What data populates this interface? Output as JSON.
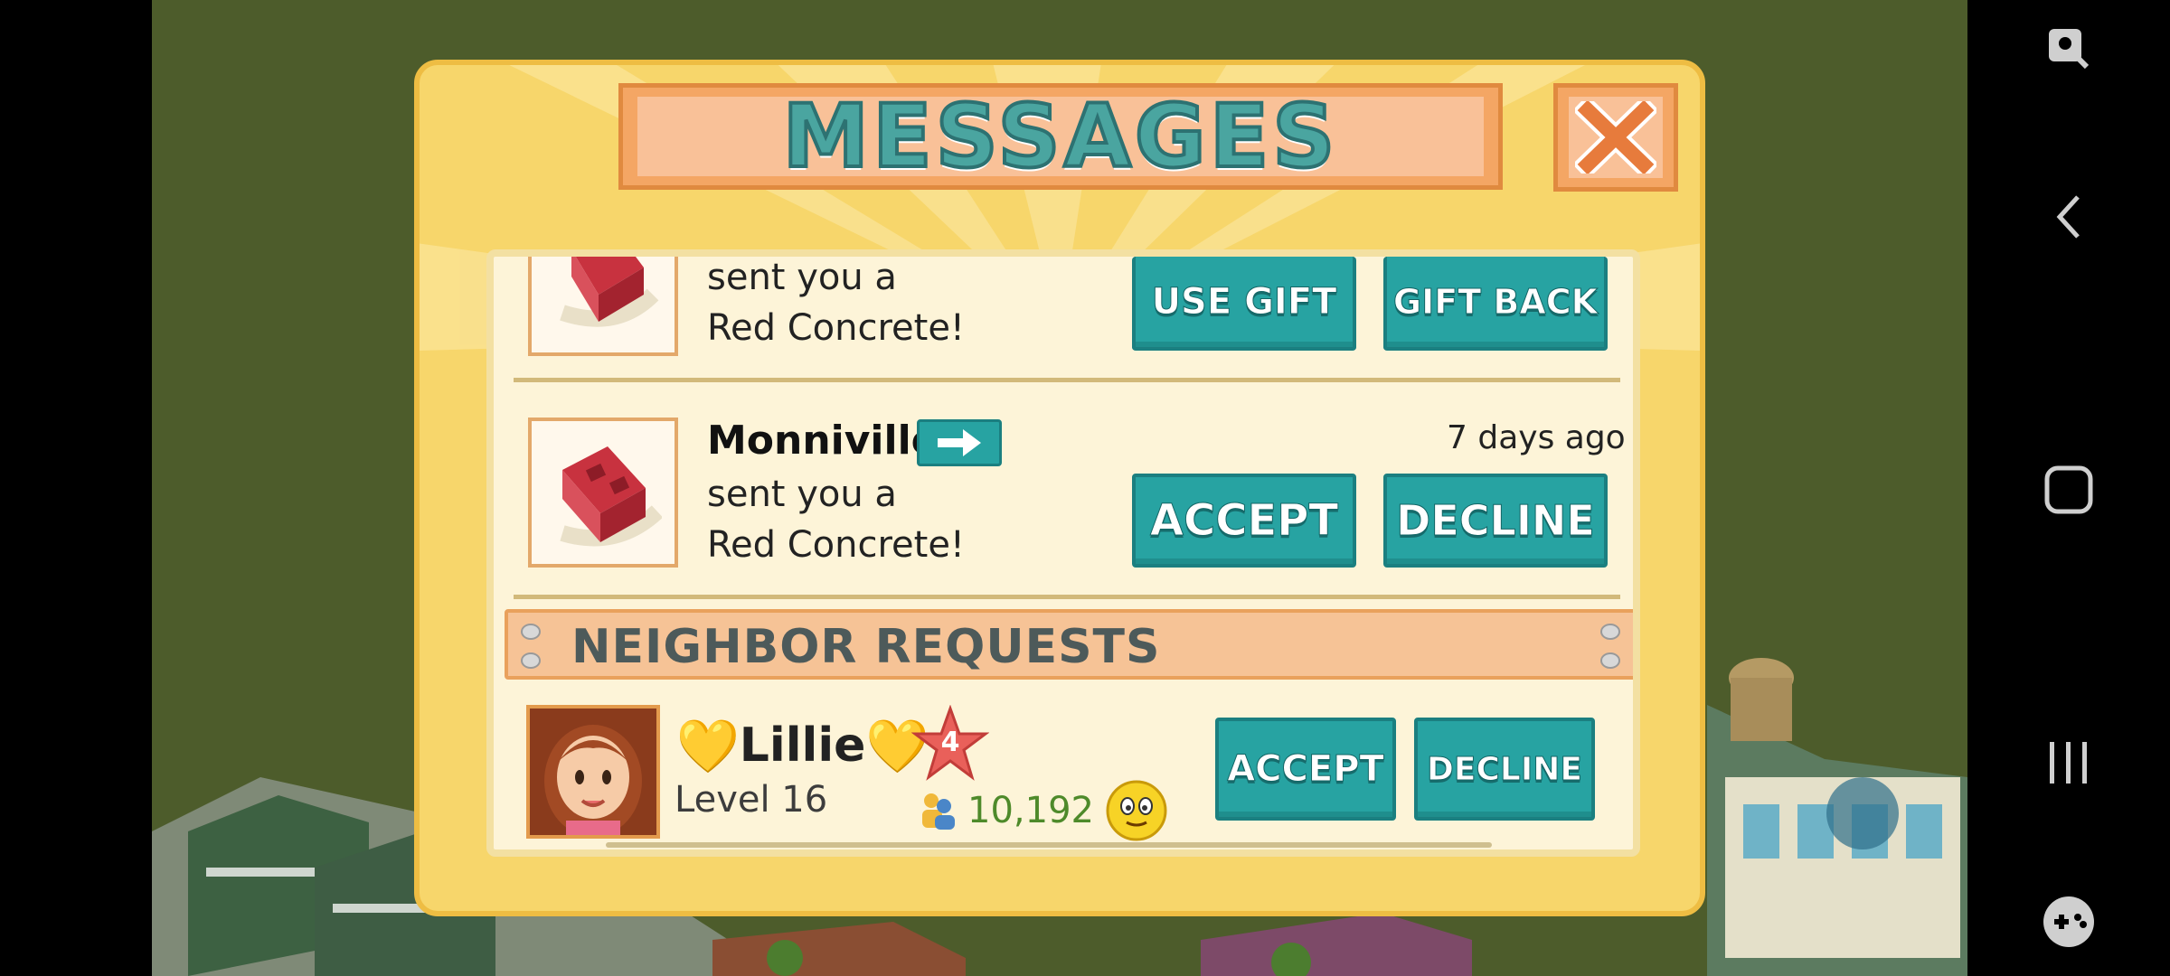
{
  "dialog": {
    "title": "MESSAGES",
    "close_label": "X"
  },
  "messages": [
    {
      "sender": "",
      "text_line1": "sent you a",
      "text_line2": "Red Concrete!",
      "primary_label": "USE GIFT",
      "secondary_label": "GIFT BACK",
      "time": "",
      "item_icon": "red-concrete-block-icon"
    },
    {
      "sender": "Monniville",
      "text_line1": "sent you a",
      "text_line2": "Red Concrete!",
      "primary_label": "ACCEPT",
      "secondary_label": "DECLINE",
      "time": "7 days ago",
      "item_icon": "red-concrete-block-icon"
    }
  ],
  "neighbor_requests": {
    "section_title": "NEIGHBOR REQUESTS",
    "items": [
      {
        "heart_left": "💛",
        "name": "Lillie",
        "heart_right": "💛",
        "level_badge": "4",
        "level_text": "Level 16",
        "population": "10,192",
        "accept_label": "ACCEPT",
        "decline_label": "DECLINE"
      }
    ]
  },
  "colors": {
    "teal_button": "#27a3a2",
    "dialog_bg": "#f7d66b",
    "title_bar": "#f4a664"
  }
}
